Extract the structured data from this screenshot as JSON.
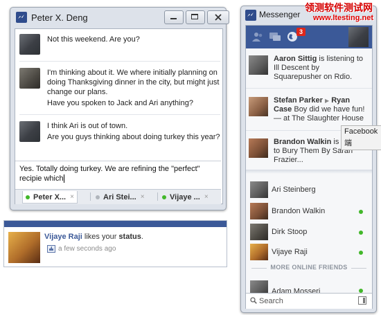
{
  "chat": {
    "title": "Peter X. Deng",
    "messages": [
      {
        "sender": "self",
        "lines": [
          "Not this weekend. Are you?"
        ]
      },
      {
        "sender": "peter",
        "lines": [
          "I'm thinking about it. We where initially planning on",
          "doing Thanksgiving dinner in the city, but might just",
          "change our plans.",
          "Have you spoken to Jack and Ari anything?"
        ]
      },
      {
        "sender": "self",
        "lines": [
          "I think Ari is out of town.",
          "Are you guys thinking about doing turkey this year?"
        ]
      }
    ],
    "compose_lines": [
      "Yes. Totally doing turkey. We are refining the \"perfect\"",
      "recipie which"
    ],
    "tabs": [
      {
        "label": "Peter X...",
        "close": "×"
      },
      {
        "label": "Ari Stei...",
        "close": "×"
      },
      {
        "label": "Vijaye ...",
        "close": "×"
      }
    ]
  },
  "notification": {
    "actor": "Vijaye Raji",
    "text_mid": " likes your ",
    "object": "status",
    "text_end": ".",
    "time": "a few seconds ago"
  },
  "messenger": {
    "title": "Messenger",
    "badge_count": "3",
    "ticker": [
      {
        "name": "Aaron Sittig",
        "text": " is listening to Ill Descent by Squarepusher on Rdio."
      },
      {
        "name": "Stefan Parker",
        "arrow": "▶",
        "name2": "Ryan Case",
        "text": " Boy did we have fun! — at The Slaughter House"
      },
      {
        "name": "Brandon Walkin",
        "text": " is listening to Bury Them By Sarah Frazier..."
      }
    ],
    "friends": [
      {
        "name": "Ari Steinberg",
        "online": false
      },
      {
        "name": "Brandon Walkin",
        "online": true
      },
      {
        "name": "Dirk Stoop",
        "online": true
      },
      {
        "name": "Vijaye Raji",
        "online": true
      }
    ],
    "more_online_label": "MORE ONLINE FRIENDS",
    "more_friends": [
      {
        "name": "Adam Mosseri",
        "online": true
      }
    ],
    "search_label": "Search"
  },
  "tooltip": {
    "line1": "Facebook",
    "line2": "端"
  },
  "watermark": {
    "line1": "领测软件测试网",
    "line2": "www.ltesting.net"
  },
  "colors": {
    "brand": "#3b5998",
    "online": "#42b72a",
    "badge": "#e0271a"
  }
}
